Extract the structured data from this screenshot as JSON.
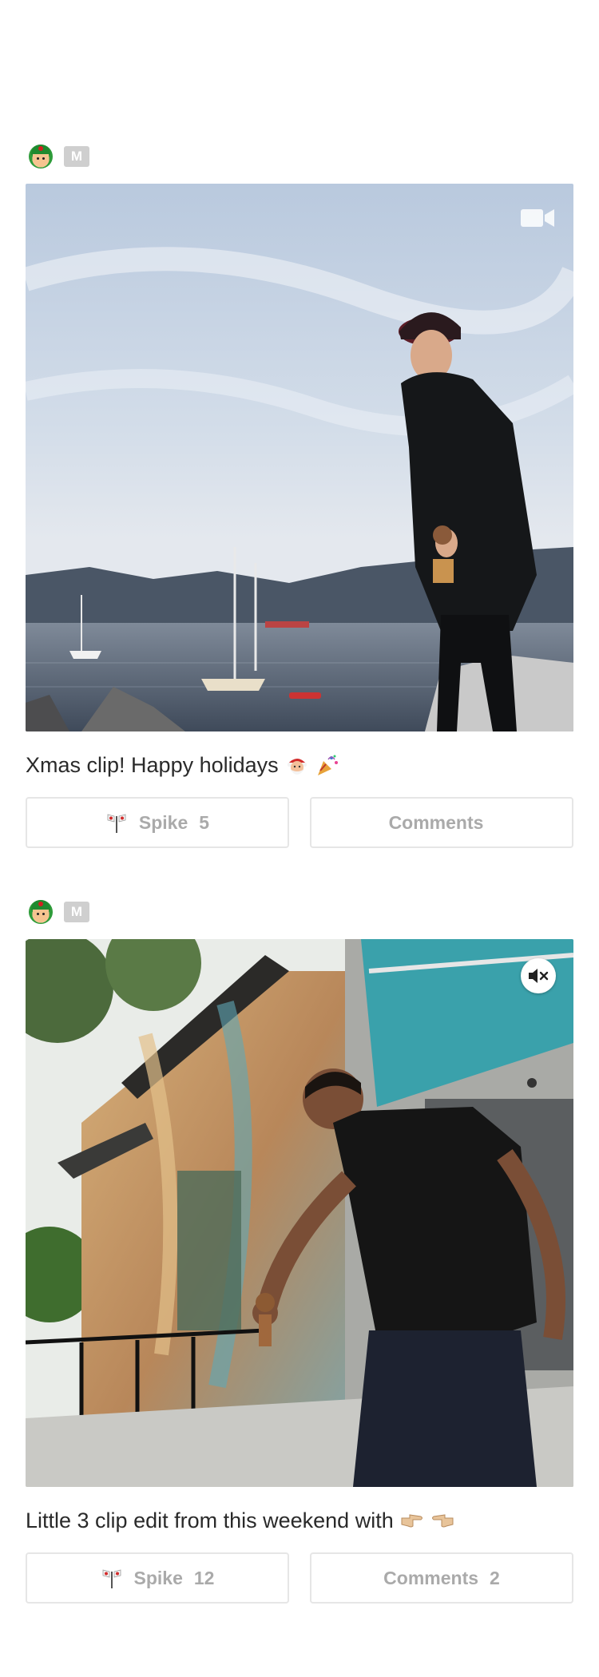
{
  "posts": [
    {
      "badge": "M",
      "caption": "Xmas clip! Happy holidays",
      "caption_emojis": [
        "santa-emoji",
        "party-popper-emoji"
      ],
      "media_indicator": "video-camera-icon",
      "spike_label": "Spike",
      "spike_count": "5",
      "comments_label": "Comments",
      "comments_count": ""
    },
    {
      "badge": "M",
      "caption": "Little 3 clip edit from this weekend with",
      "caption_emojis": [
        "pointing-right-emoji",
        "pointing-left-emoji"
      ],
      "media_indicator": "mute-icon",
      "spike_label": "Spike",
      "spike_count": "12",
      "comments_label": "Comments",
      "comments_count": "2"
    }
  ],
  "colors": {
    "button_text": "#aaaaaa",
    "button_border": "#e6e6e6",
    "badge_bg": "#cfcfcf",
    "caption_text": "#2a2a2a"
  }
}
